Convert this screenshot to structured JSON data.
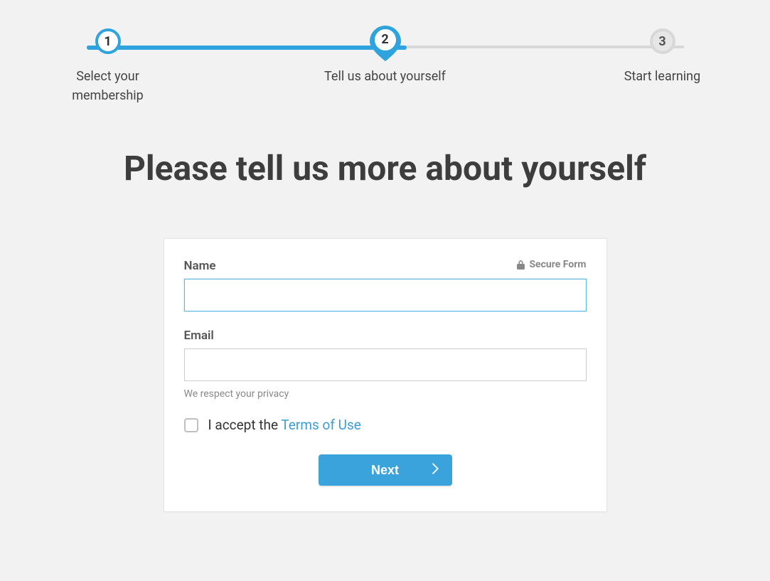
{
  "stepper": {
    "steps": [
      {
        "num": "1",
        "label": "Select your membership"
      },
      {
        "num": "2",
        "label": "Tell us about yourself"
      },
      {
        "num": "3",
        "label": "Start learning"
      }
    ]
  },
  "page": {
    "title": "Please tell us more about yourself"
  },
  "form": {
    "secure_label": "Secure Form",
    "name": {
      "label": "Name",
      "value": ""
    },
    "email": {
      "label": "Email",
      "value": "",
      "helper": "We respect your privacy"
    },
    "terms": {
      "prefix": "I accept the ",
      "link": "Terms of Use"
    },
    "next_label": "Next"
  }
}
